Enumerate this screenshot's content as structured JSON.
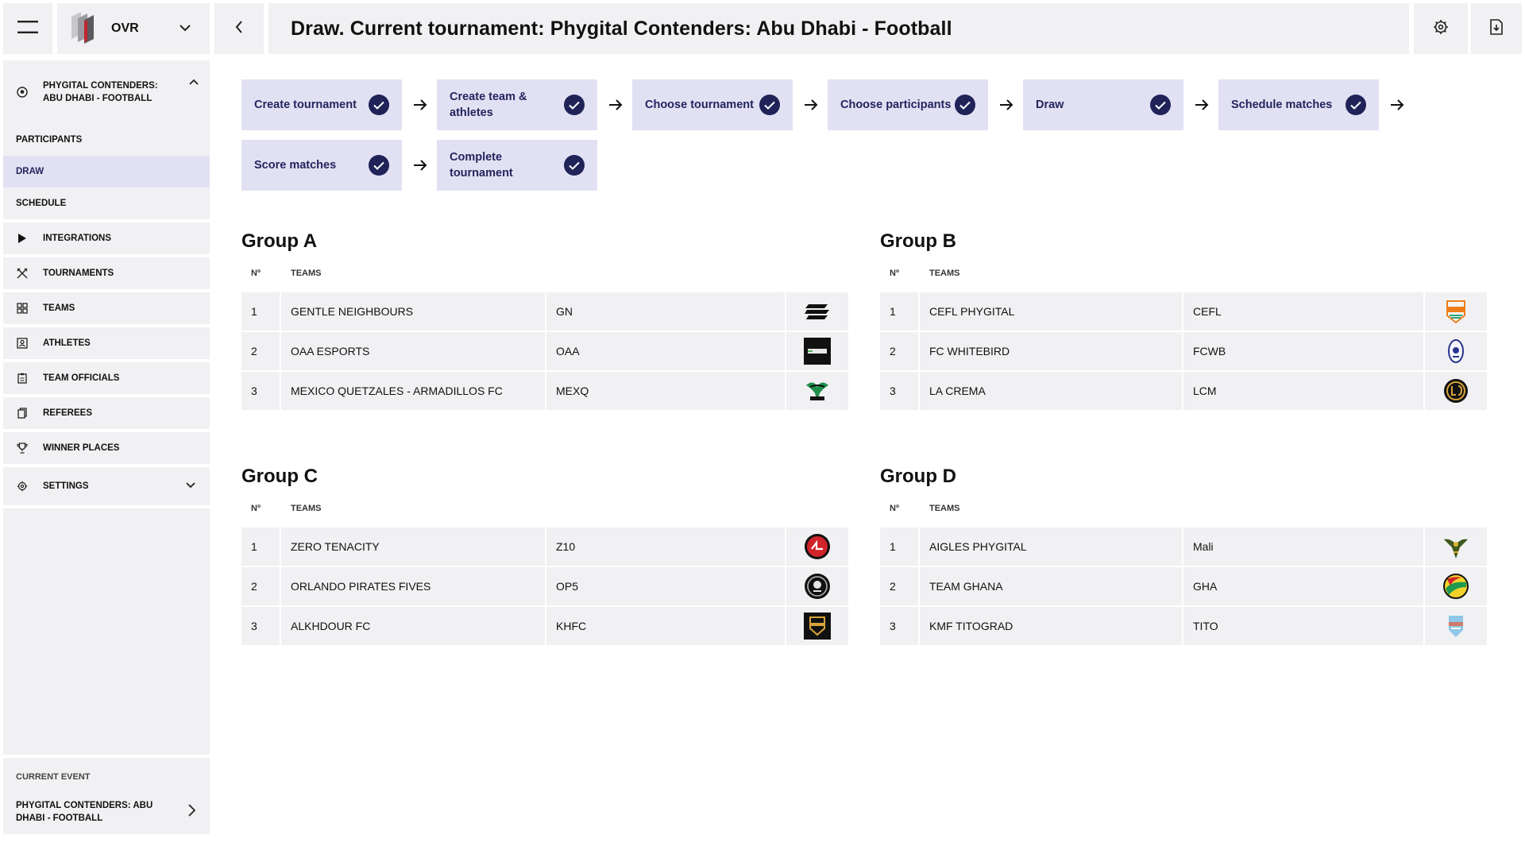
{
  "topbar": {
    "brand": "OVR",
    "title": "Draw. Current tournament: Phygital Contenders: Abu Dhabi - Football"
  },
  "sidebar": {
    "event_title": "PHYGITAL CONTENDERS: ABU DHABI - FOOTBALL",
    "sub_items": [
      "PARTICIPANTS",
      "DRAW",
      "SCHEDULE"
    ],
    "active_sub": "DRAW",
    "items": [
      {
        "label": "INTEGRATIONS",
        "icon": "play-icon"
      },
      {
        "label": "TOURNAMENTS",
        "icon": "crossed-swords-icon"
      },
      {
        "label": "TEAMS",
        "icon": "grid-icon"
      },
      {
        "label": "ATHLETES",
        "icon": "person-card-icon"
      },
      {
        "label": "TEAM OFFICIALS",
        "icon": "clipboard-icon"
      },
      {
        "label": "REFEREES",
        "icon": "copy-icon"
      },
      {
        "label": "WINNER PLACES",
        "icon": "trophy-icon"
      },
      {
        "label": "SETTINGS",
        "icon": "gear-icon"
      }
    ],
    "current_event_caption": "CURRENT EVENT",
    "current_event_name": "PHYGITAL CONTENDERS: ABU DHABI - FOOTBALL"
  },
  "steps": [
    {
      "label": "Create tournament",
      "done": true
    },
    {
      "label": "Create team & athletes",
      "done": true
    },
    {
      "label": "Choose tournament",
      "done": true
    },
    {
      "label": "Choose participants",
      "done": true
    },
    {
      "label": "Draw",
      "done": true
    },
    {
      "label": "Schedule matches",
      "done": true
    },
    {
      "label": "Score matches",
      "done": true
    },
    {
      "label": "Complete tournament",
      "done": true
    }
  ],
  "table_headers": {
    "number": "Nº",
    "teams": "TEAMS"
  },
  "groups": [
    {
      "title": "Group A",
      "teams": [
        {
          "no": "1",
          "name": "GENTLE NEIGHBOURS",
          "abbr": "GN",
          "logo": "gn-logo"
        },
        {
          "no": "2",
          "name": "OAA ESPORTS",
          "abbr": "OAA",
          "logo": "oaa-logo"
        },
        {
          "no": "3",
          "name": "MEXICO QUETZALES - ARMADILLOS FC",
          "abbr": "MEXQ",
          "logo": "mexq-logo"
        }
      ]
    },
    {
      "title": "Group B",
      "teams": [
        {
          "no": "1",
          "name": "CEFL PHYGITAL",
          "abbr": "CEFL",
          "logo": "cefl-logo"
        },
        {
          "no": "2",
          "name": "FC WHITEBIRD",
          "abbr": "FCWB",
          "logo": "fcwb-logo"
        },
        {
          "no": "3",
          "name": "LA CREMA",
          "abbr": "LCM",
          "logo": "lcm-logo"
        }
      ]
    },
    {
      "title": "Group C",
      "teams": [
        {
          "no": "1",
          "name": "ZERO TENACITY",
          "abbr": "Z10",
          "logo": "z10-logo"
        },
        {
          "no": "2",
          "name": "ORLANDO PIRATES FIVES",
          "abbr": "OP5",
          "logo": "op5-logo"
        },
        {
          "no": "3",
          "name": "ALKHDOUR FC",
          "abbr": "KHFC",
          "logo": "khfc-logo"
        }
      ]
    },
    {
      "title": "Group D",
      "teams": [
        {
          "no": "1",
          "name": "AIGLES PHYGITAL",
          "abbr": "Mali",
          "logo": "mali-logo"
        },
        {
          "no": "2",
          "name": "TEAM GHANA",
          "abbr": "GHA",
          "logo": "gha-logo"
        },
        {
          "no": "3",
          "name": "KMF TITOGRAD",
          "abbr": "TITO",
          "logo": "tito-logo"
        }
      ]
    }
  ],
  "colors": {
    "panel": "#f1f1f3",
    "accent_bg": "#e2e1f3",
    "accent_text": "#23245e",
    "check": "#1f2358"
  }
}
